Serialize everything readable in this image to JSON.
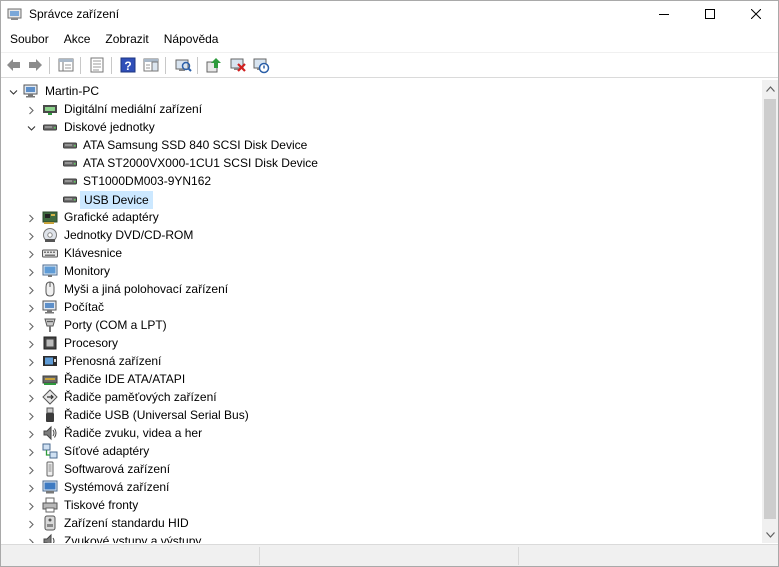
{
  "window": {
    "title": "Správce zařízení",
    "icon": "device-manager-icon"
  },
  "controls": {
    "minimize": "minimize-icon",
    "maximize": "maximize-icon",
    "close": "close-icon"
  },
  "menu": [
    {
      "label": "Soubor"
    },
    {
      "label": "Akce"
    },
    {
      "label": "Zobrazit"
    },
    {
      "label": "Nápověda"
    }
  ],
  "toolbar": [
    "back-arrow-icon",
    "forward-arrow-icon",
    "properties-sheet-icon",
    "show-hide-console-tree-icon",
    "help-icon",
    "action-pane-icon",
    "scan-hardware-changes-icon",
    "update-driver-icon",
    "uninstall-device-icon",
    "disable-device-icon"
  ],
  "tree": {
    "root": {
      "label": "Martin-PC",
      "icon": "computer-icon",
      "expanded": true
    },
    "items": [
      {
        "label": "Digitální mediální zařízení",
        "icon": "media-device-icon",
        "level": 1,
        "expanded": false
      },
      {
        "label": "Diskové jednotky",
        "icon": "disk-drive-icon",
        "level": 1,
        "expanded": true
      },
      {
        "label": "ATA Samsung SSD 840 SCSI Disk Device",
        "icon": "disk-drive-icon",
        "level": 2
      },
      {
        "label": "ATA ST2000VX000-1CU1 SCSI Disk Device",
        "icon": "disk-drive-icon",
        "level": 2
      },
      {
        "label": "ST1000DM003-9YN162",
        "icon": "disk-drive-icon",
        "level": 2
      },
      {
        "label": "USB Device",
        "icon": "disk-drive-icon",
        "level": 2,
        "selected": true
      },
      {
        "label": "Grafické adaptéry",
        "icon": "display-adapter-icon",
        "level": 1,
        "expanded": false
      },
      {
        "label": "Jednotky DVD/CD-ROM",
        "icon": "dvd-drive-icon",
        "level": 1,
        "expanded": false
      },
      {
        "label": "Klávesnice",
        "icon": "keyboard-icon",
        "level": 1,
        "expanded": false
      },
      {
        "label": "Monitory",
        "icon": "monitor-icon",
        "level": 1,
        "expanded": false
      },
      {
        "label": "Myši a jiná polohovací zařízení",
        "icon": "mouse-icon",
        "level": 1,
        "expanded": false
      },
      {
        "label": "Počítač",
        "icon": "computer-icon",
        "level": 1,
        "expanded": false
      },
      {
        "label": "Porty (COM a LPT)",
        "icon": "port-icon",
        "level": 1,
        "expanded": false
      },
      {
        "label": "Procesory",
        "icon": "processor-icon",
        "level": 1,
        "expanded": false
      },
      {
        "label": "Přenosná zařízení",
        "icon": "portable-device-icon",
        "level": 1,
        "expanded": false
      },
      {
        "label": "Řadiče IDE ATA/ATAPI",
        "icon": "ide-controller-icon",
        "level": 1,
        "expanded": false
      },
      {
        "label": "Řadiče paměťových zařízení",
        "icon": "storage-controller-icon",
        "level": 1,
        "expanded": false
      },
      {
        "label": "Řadiče USB (Universal Serial Bus)",
        "icon": "usb-icon",
        "level": 1,
        "expanded": false
      },
      {
        "label": "Řadiče zvuku, videa a her",
        "icon": "speaker-icon",
        "level": 1,
        "expanded": false
      },
      {
        "label": "Síťové adaptéry",
        "icon": "network-adapter-icon",
        "level": 1,
        "expanded": false
      },
      {
        "label": "Softwarová zařízení",
        "icon": "software-device-icon",
        "level": 1,
        "expanded": false
      },
      {
        "label": "Systémová zařízení",
        "icon": "system-device-icon",
        "level": 1,
        "expanded": false
      },
      {
        "label": "Tiskové fronty",
        "icon": "printer-icon",
        "level": 1,
        "expanded": false
      },
      {
        "label": "Zařízení standardu HID",
        "icon": "hid-icon",
        "level": 1,
        "expanded": false
      },
      {
        "label": "Zvukové vstupy a výstupy",
        "icon": "audio-io-icon",
        "level": 1,
        "expanded": false
      }
    ]
  },
  "scrollbar": {
    "up": "scroll-up-arrow-icon",
    "down": "scroll-down-arrow-icon"
  }
}
